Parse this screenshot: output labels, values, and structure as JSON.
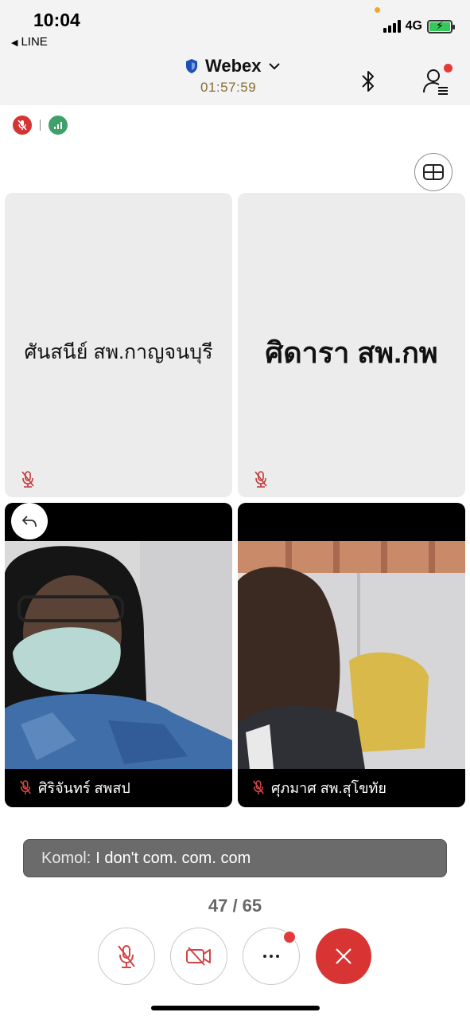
{
  "status_bar": {
    "time": "10:04",
    "back_app": "LINE",
    "network": "4G",
    "battery_charging": true
  },
  "meeting": {
    "title": "Webex",
    "timer": "01:57:59",
    "secure": true
  },
  "header_icons": [
    "bluetooth-icon",
    "participants-icon"
  ],
  "indicators": [
    "mic-muted-icon",
    "network-quality-icon"
  ],
  "tiles": [
    {
      "name": "ศันสนีย์ สพ.กาญจนบุรี",
      "type": "avatar-name",
      "muted": true
    },
    {
      "name": "ศิดารา สพ.กพ",
      "type": "avatar-name",
      "muted": true
    },
    {
      "name": "ศิริจันทร์ สพสป",
      "type": "video",
      "muted": true
    },
    {
      "name": "ศุภมาศ สพ.สุโขทัย",
      "type": "video",
      "muted": true
    }
  ],
  "chat_toast": {
    "sender": "Komol:",
    "message": "I don't com. com. com"
  },
  "pagination": "47 / 65",
  "controls": [
    {
      "name": "mute-button",
      "icon": "mic-off-icon"
    },
    {
      "name": "video-button",
      "icon": "video-off-icon"
    },
    {
      "name": "more-button",
      "icon": "more-icon",
      "badge": true
    },
    {
      "name": "leave-button",
      "icon": "close-icon"
    }
  ],
  "colors": {
    "accent_red": "#d93434",
    "timer": "#8a6d2f",
    "tile_bg": "#ececec",
    "network_green": "#3fa06a"
  }
}
